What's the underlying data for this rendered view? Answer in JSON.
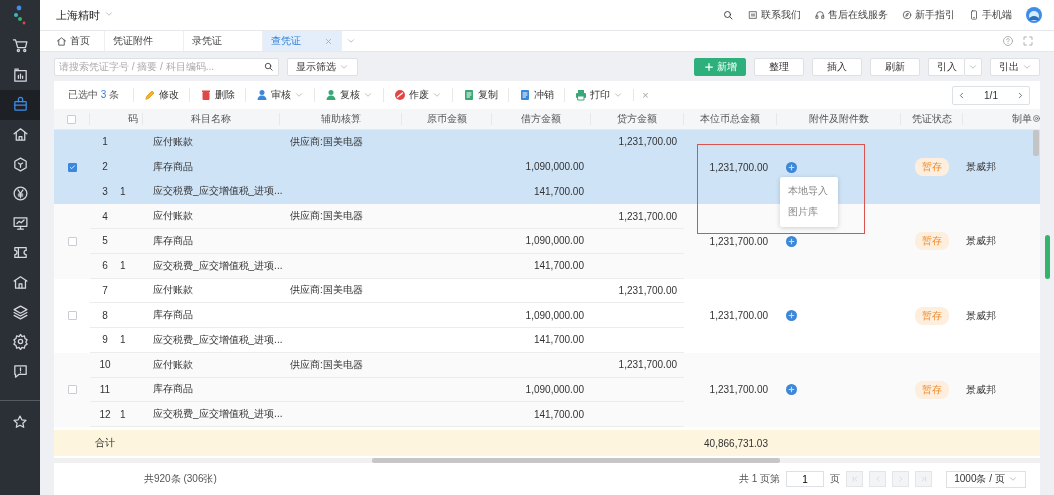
{
  "sidebar": {
    "items": [
      {
        "selected": false
      },
      {
        "selected": false
      },
      {
        "selected": true
      },
      {
        "selected": false
      },
      {
        "selected": false
      },
      {
        "selected": false
      },
      {
        "selected": false
      },
      {
        "selected": false
      },
      {
        "selected": false
      },
      {
        "selected": false
      },
      {
        "selected": false
      },
      {
        "selected": false
      }
    ],
    "bottom_items": [
      {
        "selected": false
      }
    ]
  },
  "topbar": {
    "company": "上海精时",
    "links": [
      "联系我们",
      "售后在线服务",
      "新手指引",
      "手机端"
    ]
  },
  "tabs": [
    {
      "label": "首页",
      "selected": false,
      "closable": false
    },
    {
      "label": "凭证附件",
      "selected": false,
      "closable": false
    },
    {
      "label": "录凭证",
      "selected": false,
      "closable": false
    },
    {
      "label": "查凭证",
      "selected": true,
      "closable": true
    }
  ],
  "search": {
    "placeholder": "请搜索凭证字号 / 摘要 / 科目编码..."
  },
  "filter_button": "显示筛选",
  "actions": {
    "primary": "新增",
    "buttons": [
      "整理",
      "插入",
      "刷新"
    ],
    "import": "引入",
    "export": "引出"
  },
  "toolbar": {
    "selected_prefix": "已选中",
    "selected_count": "3",
    "selected_suffix": "条",
    "items": [
      {
        "label": "修改",
        "kind": "edit",
        "dropdown": false
      },
      {
        "label": "删除",
        "kind": "delete",
        "dropdown": false
      },
      {
        "label": "审核",
        "kind": "audit",
        "dropdown": true
      },
      {
        "label": "复核",
        "kind": "review",
        "dropdown": true
      },
      {
        "label": "作废",
        "kind": "void",
        "dropdown": true
      },
      {
        "label": "复制",
        "kind": "copy",
        "dropdown": false
      },
      {
        "label": "冲销",
        "kind": "reverse",
        "dropdown": false
      },
      {
        "label": "打印",
        "kind": "print",
        "dropdown": true
      }
    ],
    "clear": "×",
    "pager": "1/1"
  },
  "table": {
    "header_checked": false,
    "columns": [
      "码",
      "科目名称",
      "辅助核算",
      "原币金额",
      "借方金额",
      "贷方金额",
      "本位币总金额",
      "附件及附件数",
      "凭证状态",
      "制单"
    ],
    "highlight_frame": true,
    "attach_menu": [
      "本地导入",
      "图片库"
    ],
    "groups": [
      {
        "checked": true,
        "selected": true,
        "total": "1,231,700.00",
        "status": "暂存",
        "maker": "景威邦",
        "lines": [
          {
            "seq": "1",
            "name": "应付账款",
            "aux": "供应商:国美电器",
            "credit": "1,231,700.00"
          },
          {
            "seq": "2",
            "name": "库存商品",
            "debit": "1,090,000.00"
          },
          {
            "seq": "3",
            "code": "1",
            "name": "应交税费_应交增值税_进项...",
            "debit": "141,700.00"
          }
        ]
      },
      {
        "checked": false,
        "selected": false,
        "total": "1,231,700.00",
        "status": "暂存",
        "maker": "景威邦",
        "lines": [
          {
            "seq": "4",
            "name": "应付账款",
            "aux": "供应商:国美电器",
            "credit": "1,231,700.00"
          },
          {
            "seq": "5",
            "name": "库存商品",
            "debit": "1,090,000.00"
          },
          {
            "seq": "6",
            "code": "1",
            "name": "应交税费_应交增值税_进项...",
            "debit": "141,700.00"
          }
        ]
      },
      {
        "checked": false,
        "selected": false,
        "total": "1,231,700.00",
        "status": "暂存",
        "maker": "景威邦",
        "lines": [
          {
            "seq": "7",
            "name": "应付账款",
            "aux": "供应商:国美电器",
            "credit": "1,231,700.00"
          },
          {
            "seq": "8",
            "name": "库存商品",
            "debit": "1,090,000.00"
          },
          {
            "seq": "9",
            "code": "1",
            "name": "应交税费_应交增值税_进项...",
            "debit": "141,700.00"
          }
        ]
      },
      {
        "checked": false,
        "selected": false,
        "total": "1,231,700.00",
        "status": "暂存",
        "maker": "景威邦",
        "lines": [
          {
            "seq": "10",
            "name": "应付账款",
            "aux": "供应商:国美电器",
            "credit": "1,231,700.00"
          },
          {
            "seq": "11",
            "name": "库存商品",
            "debit": "1,090,000.00"
          },
          {
            "seq": "12",
            "code": "1",
            "name": "应交税费_应交增值税_进项...",
            "debit": "141,700.00"
          }
        ]
      }
    ],
    "total_label": "合计",
    "grand_total": "40,866,731.03"
  },
  "footer": {
    "summary": "共920条 (306张)",
    "pages_prefix": "共 1 页第",
    "page": "1",
    "pages_suffix": "页",
    "page_size": "1000条 / 页"
  }
}
